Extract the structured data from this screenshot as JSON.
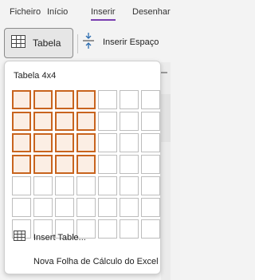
{
  "ribbon": {
    "tabs": [
      {
        "label": "Ficheiro"
      },
      {
        "label": "Início"
      },
      {
        "label": "Inserir"
      },
      {
        "label": "Desenhar"
      }
    ],
    "active_tab": "Inserir",
    "accent_color": "#7a3fb0"
  },
  "toolbar": {
    "table_button": {
      "label": "Tabela",
      "icon": "table-grid-icon"
    },
    "insert_space": {
      "label": "Inserir Espaço",
      "icon": "insert-space-icon"
    }
  },
  "dropdown": {
    "title": "Tabela 4x4",
    "grid": {
      "columns": 7,
      "rows": 7,
      "selected_columns": 4,
      "selected_rows": 4,
      "highlight_color": "#c8641e"
    },
    "items": [
      {
        "label": "Insert Table...",
        "icon": "table-grid-icon"
      },
      {
        "label": "Nova Folha de Cálculo do Excel"
      }
    ]
  }
}
